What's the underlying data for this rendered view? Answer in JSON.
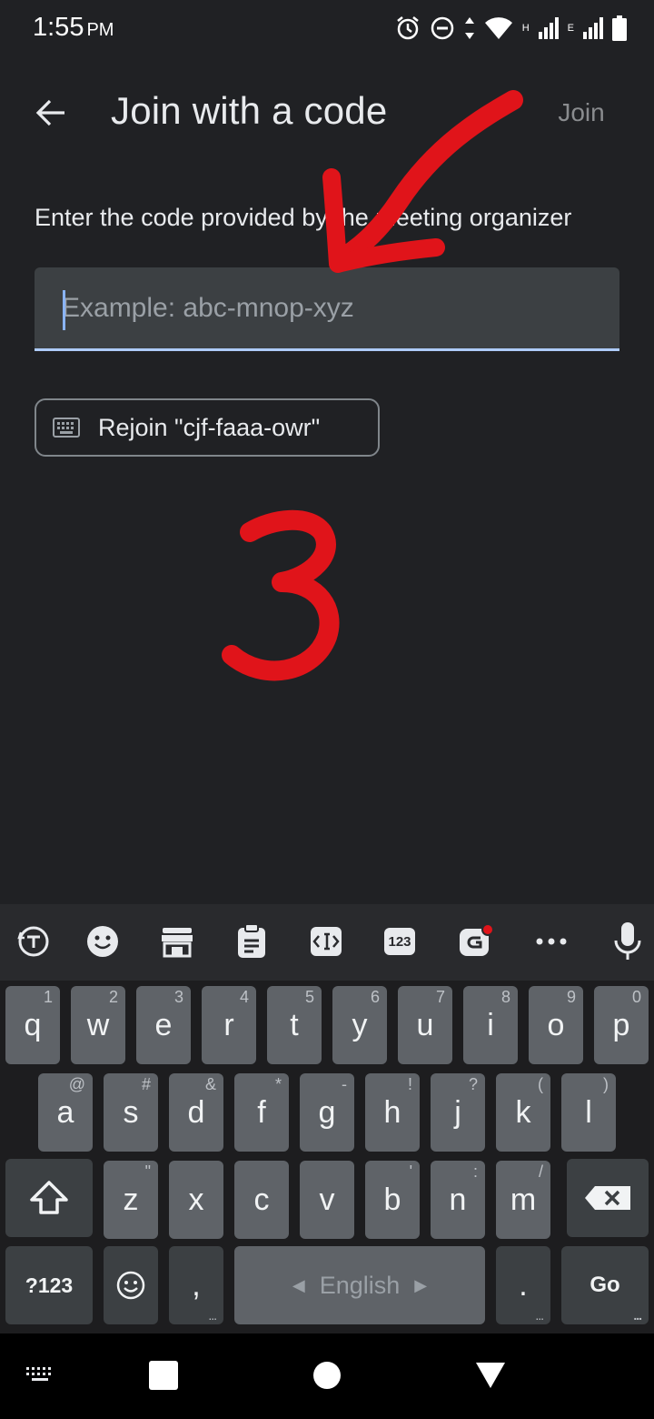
{
  "status_bar": {
    "time": "1:55",
    "ampm": "PM",
    "network_h": "H",
    "network_e": "E"
  },
  "app_bar": {
    "title": "Join with a code",
    "join_label": "Join"
  },
  "instructions": "Enter the code provided by the meeting organizer",
  "code_input": {
    "value": "",
    "placeholder": "Example: abc-mnop-xyz"
  },
  "rejoin_label": "Rejoin \"cjf-faaa-owr\"",
  "annotation_number": "3",
  "keyboard": {
    "toolbar_123": "123",
    "row1": [
      {
        "label": "q",
        "hint": "1"
      },
      {
        "label": "w",
        "hint": "2"
      },
      {
        "label": "e",
        "hint": "3"
      },
      {
        "label": "r",
        "hint": "4"
      },
      {
        "label": "t",
        "hint": "5"
      },
      {
        "label": "y",
        "hint": "6"
      },
      {
        "label": "u",
        "hint": "7"
      },
      {
        "label": "i",
        "hint": "8"
      },
      {
        "label": "o",
        "hint": "9"
      },
      {
        "label": "p",
        "hint": "0"
      }
    ],
    "row2": [
      {
        "label": "a",
        "hint": "@"
      },
      {
        "label": "s",
        "hint": "#"
      },
      {
        "label": "d",
        "hint": "&"
      },
      {
        "label": "f",
        "hint": "*"
      },
      {
        "label": "g",
        "hint": "-"
      },
      {
        "label": "h",
        "hint": "!"
      },
      {
        "label": "j",
        "hint": "?"
      },
      {
        "label": "k",
        "hint": "("
      },
      {
        "label": "l",
        "hint": ")"
      }
    ],
    "row3": [
      {
        "label": "z",
        "hint": "\""
      },
      {
        "label": "x",
        "hint": ""
      },
      {
        "label": "c",
        "hint": ""
      },
      {
        "label": "v",
        "hint": ""
      },
      {
        "label": "b",
        "hint": "'"
      },
      {
        "label": "n",
        "hint": ":"
      },
      {
        "label": "m",
        "hint": "/"
      }
    ],
    "symbols_key": "?123",
    "comma_key": ",",
    "space_label": "English",
    "period_key": ".",
    "go_key": "Go",
    "more_dots": "..."
  },
  "colors": {
    "background": "#202124",
    "accent": "#8ab4f8",
    "annotation": "#e0141a"
  }
}
